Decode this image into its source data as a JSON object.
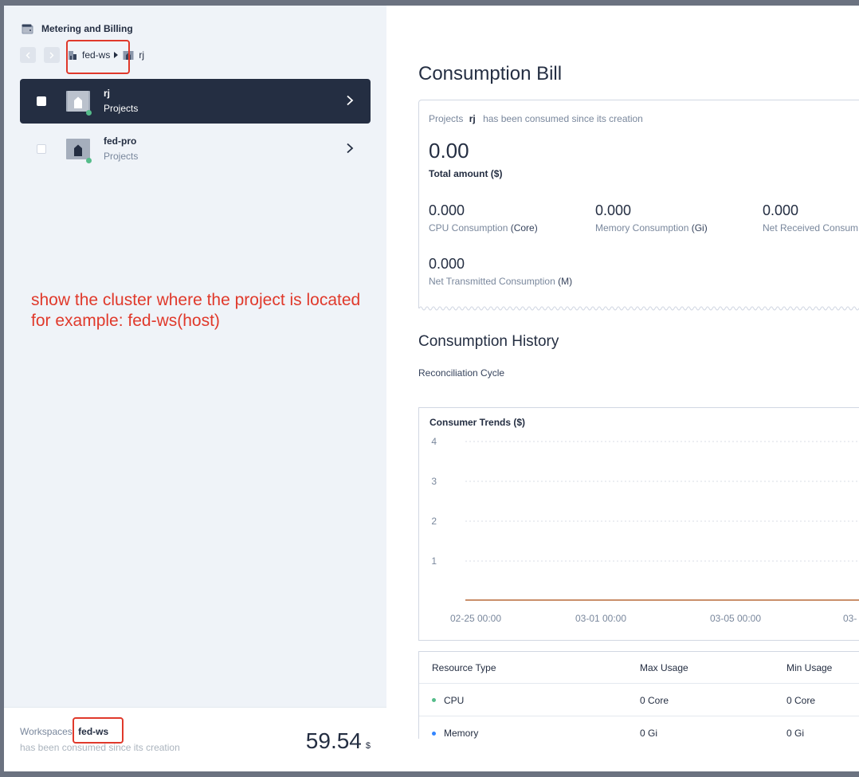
{
  "app": {
    "title": "Metering and Billing",
    "icon": "wallet-icon"
  },
  "breadcrumb": {
    "items": [
      {
        "label": "fed-ws",
        "icon": "workspace-icon"
      },
      {
        "label": "rj",
        "icon": "project-icon"
      }
    ]
  },
  "projects": [
    {
      "name": "rj",
      "type": "Projects",
      "status_color": "#55bc8a",
      "active": true
    },
    {
      "name": "fed-pro",
      "type": "Projects",
      "status_color": "#55bc8a",
      "active": false
    }
  ],
  "annotation": {
    "line1": "show the cluster where the project is located",
    "line2": "for example: fed-ws(host)",
    "color": "#e0392b"
  },
  "workspace_footer": {
    "label": "Workspaces",
    "name": "fed-ws",
    "subtitle": "has been consumed since its creation",
    "amount": "59.54",
    "unit": "$"
  },
  "bill": {
    "heading": "Consumption Bill",
    "desc_prefix": "Projects",
    "desc_name": "rj",
    "desc_suffix": "has been consumed since its creation",
    "total": "0.00",
    "total_label": "Total amount ($)",
    "metrics": [
      {
        "value": "0.000",
        "label": "CPU Consumption",
        "unit": "(Core)"
      },
      {
        "value": "0.000",
        "label": "Memory Consumption",
        "unit": "(Gi)"
      },
      {
        "value": "0.000",
        "label": "Net Received Consum",
        "unit": ""
      },
      {
        "value": "0.000",
        "label": "Net Transmitted Consumption",
        "unit": "(M)"
      }
    ]
  },
  "history": {
    "heading": "Consumption History",
    "reconciliation": "Reconciliation Cycle"
  },
  "chart_data": {
    "type": "line",
    "title": "Consumer Trends ($)",
    "x": [
      "02-25 00:00",
      "03-01 00:00",
      "03-05 00:00",
      "03-"
    ],
    "series": [
      {
        "values": [
          0,
          0,
          0,
          0
        ],
        "color": "#b86a3a"
      }
    ],
    "yticks": [
      1,
      2,
      3,
      4
    ],
    "ylim": [
      0,
      4
    ],
    "grid": true
  },
  "table": {
    "headers": [
      "Resource Type",
      "Max Usage",
      "Min Usage"
    ],
    "rows": [
      {
        "type": "CPU",
        "max": "0 Core",
        "min": "0 Core",
        "color": "#55bc8a"
      },
      {
        "type": "Memory",
        "max": "0 Gi",
        "min": "0 Gi",
        "color": "#3385ff"
      }
    ]
  }
}
